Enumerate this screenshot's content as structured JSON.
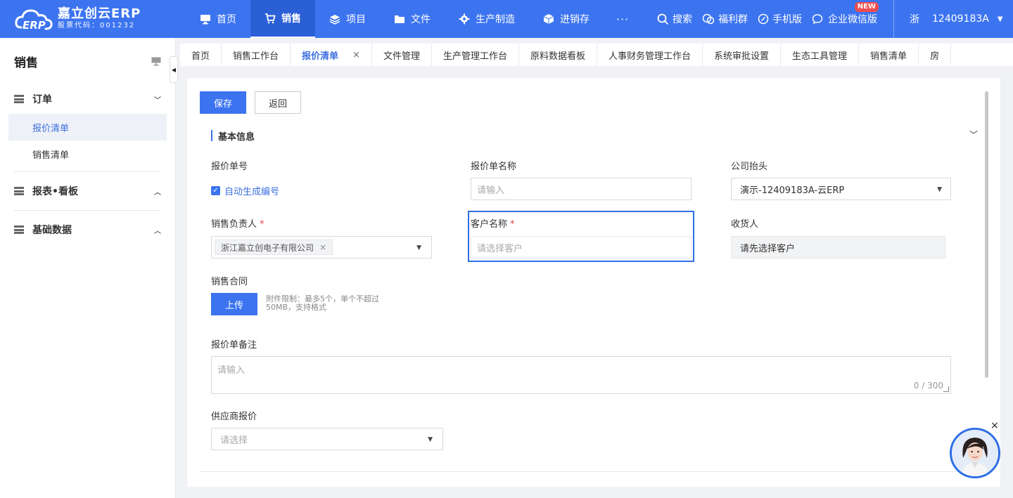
{
  "brand": {
    "name": "嘉立创云ERP",
    "stock_code": "股票代码：001232",
    "logo_glyph": "ERP",
    "accent_color": "#3c74f0"
  },
  "top_nav": [
    {
      "label": "首页",
      "icon": "monitor-icon"
    },
    {
      "label": "销售",
      "icon": "cart-icon",
      "active": true
    },
    {
      "label": "项目",
      "icon": "layers-icon"
    },
    {
      "label": "文件",
      "icon": "folder-icon"
    },
    {
      "label": "生产制造",
      "icon": "gear-icon"
    },
    {
      "label": "进销存",
      "icon": "box-icon"
    }
  ],
  "top_nav_more": "···",
  "tools": {
    "search": "搜索",
    "welfare": "福利群",
    "mobile": "手机版",
    "wecom": "企业微信版",
    "new_badge": "NEW"
  },
  "user": {
    "province": "浙",
    "account": "12409183A"
  },
  "sidebar": {
    "title": "销售",
    "groups": [
      {
        "label": "订单",
        "expanded": true,
        "items": [
          "报价清单",
          "销售清单"
        ]
      },
      {
        "label": "报表•看板",
        "expanded": false
      },
      {
        "label": "基础数据",
        "expanded": false
      }
    ],
    "active_item": "报价清单"
  },
  "tabs": [
    {
      "label": "首页"
    },
    {
      "label": "销售工作台"
    },
    {
      "label": "报价清单",
      "active": true,
      "close": "×"
    },
    {
      "label": "文件管理"
    },
    {
      "label": "生产管理工作台"
    },
    {
      "label": "原料数据看板"
    },
    {
      "label": "人事财务管理工作台"
    },
    {
      "label": "系统审批设置"
    },
    {
      "label": "生态工具管理"
    },
    {
      "label": "销售清单"
    },
    {
      "label": "房"
    }
  ],
  "form": {
    "save_button": "保存",
    "back_button": "返回",
    "section_title": "基本信息",
    "quote_no_label": "报价单号",
    "auto_number_label": "自动生成编号",
    "auto_number_checked": true,
    "quote_name_label": "报价单名称",
    "quote_name_placeholder": "请输入",
    "company_label": "公司抬头",
    "company_value": "演示-12409183A-云ERP",
    "sales_owner_label": "销售负责人",
    "sales_owner_tag": "浙江嘉立创电子有限公司",
    "tag_close": "×",
    "customer_label": "客户名称",
    "customer_placeholder": "请选择客户",
    "required_mark": "*",
    "receiver_label": "收货人",
    "receiver_value": "请先选择客户",
    "contract_label": "销售合同",
    "upload_button": "上传",
    "upload_hint_1": "附件限制：最多5个，单个不超过",
    "upload_hint_2": "50MB，支持格式",
    "remark_label": "报价单备注",
    "remark_placeholder": "请输入",
    "remark_counter": "0 / 300",
    "supplier_label": "供应商报价",
    "supplier_placeholder": "请选择"
  },
  "assistant": {
    "close": "×"
  }
}
